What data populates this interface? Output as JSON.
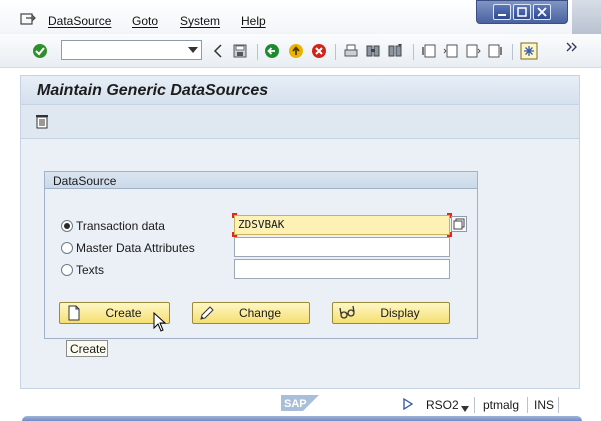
{
  "menu": {
    "icon": "menu-icon",
    "items": [
      {
        "label": "DataSource"
      },
      {
        "label": "Goto"
      },
      {
        "label": "System"
      },
      {
        "label": "Help"
      }
    ]
  },
  "window_controls": {
    "icons": [
      "minimize-icon",
      "maximize-icon",
      "close-icon"
    ]
  },
  "toolbar": {
    "command_field": {
      "value": "",
      "placeholder": ""
    },
    "icons": [
      "enter-checkmark-icon",
      "command-dropdown-icon",
      "collapse-arrow-icon",
      "save-icon",
      "back-icon",
      "exit-icon",
      "cancel-icon",
      "print-icon",
      "find-icon",
      "find-next-icon",
      "first-page-icon",
      "previous-page-icon",
      "next-page-icon",
      "last-page-icon",
      "layout-menu-icon",
      "more-icon"
    ],
    "colors": {
      "back": "#1f8a2e",
      "exit": "#e8b400",
      "cancel": "#d0241b"
    }
  },
  "page": {
    "title": "Maintain Generic DataSources",
    "app_toolbar_icon": "trash-icon"
  },
  "datasource_group": {
    "title": "DataSource",
    "options": [
      {
        "label": "Transaction data",
        "checked": true
      },
      {
        "label": "Master Data Attributes",
        "checked": false
      },
      {
        "label": "Texts",
        "checked": false
      }
    ],
    "fields": [
      {
        "value": "ZDSVBAK",
        "focused": true
      },
      {
        "value": "",
        "focused": false
      },
      {
        "value": "",
        "focused": false
      }
    ],
    "f4_help_icon": "value-help-icon",
    "buttons": [
      {
        "label": "Create",
        "icon": "new-document-icon"
      },
      {
        "label": "Change",
        "icon": "pencil-icon"
      },
      {
        "label": "Display",
        "icon": "glasses-icon"
      }
    ]
  },
  "tooltip": {
    "text": "Create"
  },
  "statusbar": {
    "logo": "sap-logo",
    "transaction": "RSO2",
    "user": "ptmalg",
    "mode": "INS"
  },
  "colors": {
    "title_bar": "#d5e1ee",
    "content_bg": "#eaf0f6",
    "button_fill": "#f5df73",
    "focused_field": "#fdf1b5",
    "window_controls": "#4a62a0"
  }
}
